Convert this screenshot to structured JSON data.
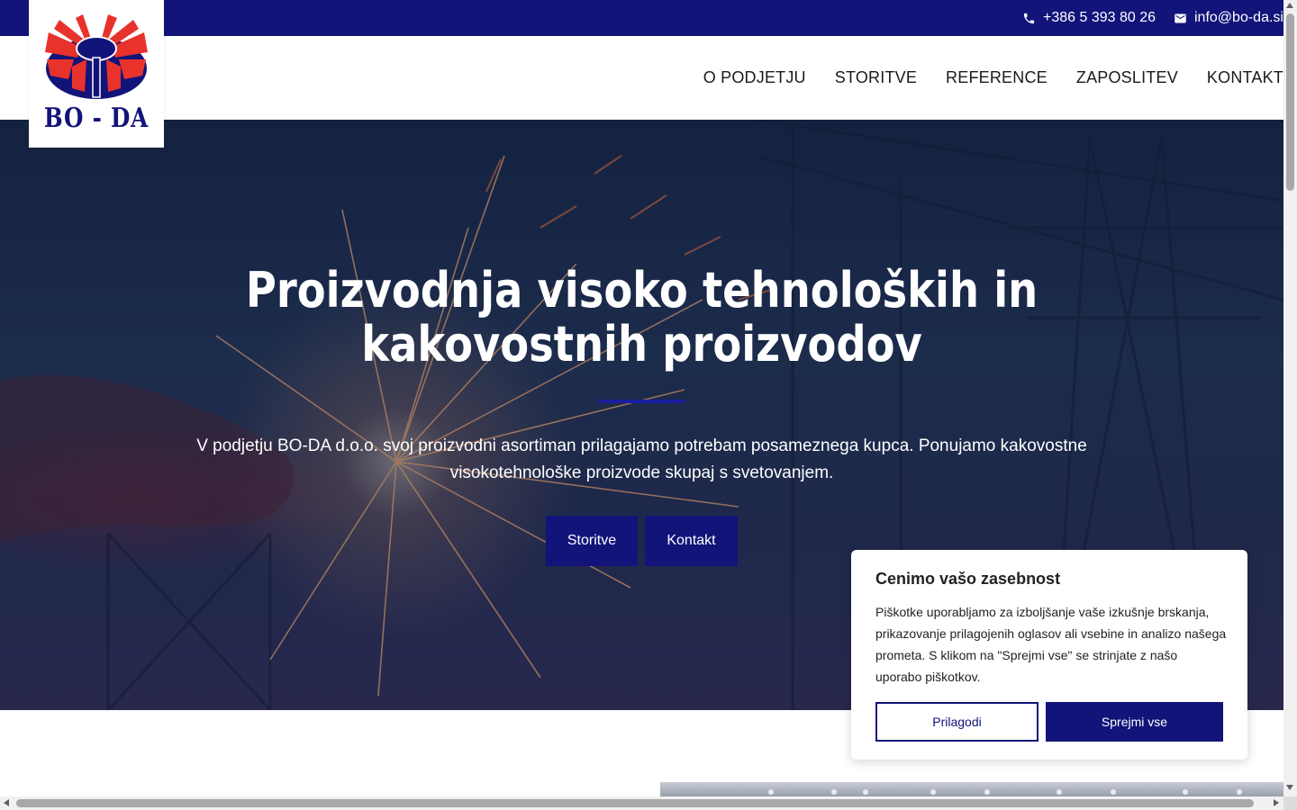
{
  "topbar": {
    "phone": "+386 5 393 80 26",
    "email": "info@bo-da.si",
    "phone_icon": "phone-icon",
    "email_icon": "mail-icon"
  },
  "logo": {
    "text": "BO - DA"
  },
  "nav": {
    "items": [
      {
        "label": "O PODJETJU"
      },
      {
        "label": "STORITVE"
      },
      {
        "label": "REFERENCE"
      },
      {
        "label": "ZAPOSLITEV"
      },
      {
        "label": "KONTAKT"
      }
    ]
  },
  "hero": {
    "title_line1": "Proizvodnja visoko tehnoloških in",
    "title_line2": "kakovostnih proizvodov",
    "text_line1": "V podjetju BO-DA d.o.o. svoj proizvodni asortiman prilagajamo potrebam posameznega kupca. Ponujamo kakovostne",
    "text_line2": "visokotehnološke proizvode skupaj s svetovanjem.",
    "btn_storitve": "Storitve",
    "btn_kontakt": "Kontakt"
  },
  "cookie": {
    "title": "Cenimo vašo zasebnost",
    "text": "Piškotke uporabljamo za izboljšanje vaše izkušnje brskanja, prikazovanje prilagojenih oglasov ali vsebine in analizo našega prometa. S klikom na \"Sprejmi vse\" se strinjate z našo uporabo piškotkov.",
    "btn_customize": "Prilagodi",
    "btn_accept": "Sprejmi vse"
  },
  "colors": {
    "brand_navy": "#12147a",
    "logo_red": "#e8322c",
    "accent_blue": "#1a1e9e"
  }
}
